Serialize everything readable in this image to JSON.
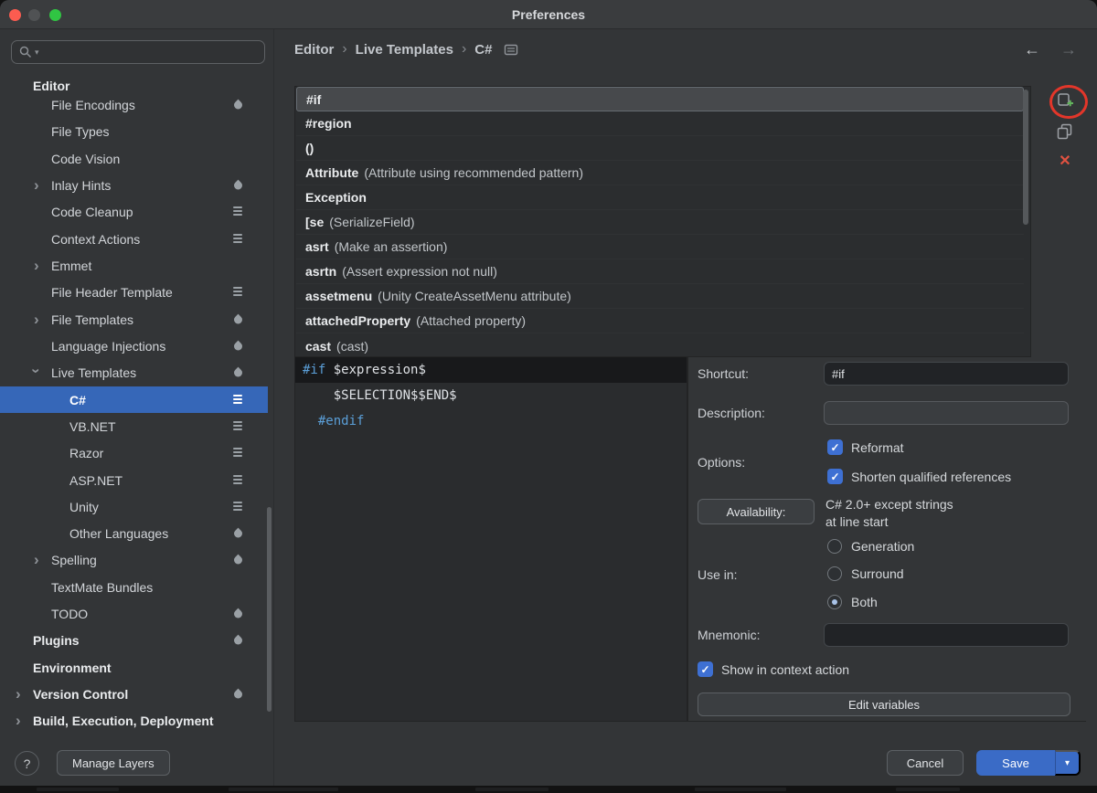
{
  "window": {
    "title": "Preferences"
  },
  "sidebar": {
    "search": {
      "placeholder": ""
    },
    "items": [
      {
        "label": "Editor",
        "level": 0,
        "bold": true
      },
      {
        "label": "File Encodings",
        "level": 1,
        "icon": "droplet"
      },
      {
        "label": "File Types",
        "level": 1
      },
      {
        "label": "Code Vision",
        "level": 1
      },
      {
        "label": "Inlay Hints",
        "level": 1,
        "chevron": "collapsed",
        "icon": "droplet"
      },
      {
        "label": "Code Cleanup",
        "level": 1,
        "icon": "stack"
      },
      {
        "label": "Context Actions",
        "level": 1,
        "icon": "stack"
      },
      {
        "label": "Emmet",
        "level": 1,
        "chevron": "collapsed"
      },
      {
        "label": "File Header Template",
        "level": 1,
        "icon": "stack"
      },
      {
        "label": "File Templates",
        "level": 1,
        "chevron": "collapsed",
        "icon": "droplet"
      },
      {
        "label": "Language Injections",
        "level": 1,
        "icon": "droplet"
      },
      {
        "label": "Live Templates",
        "level": 1,
        "chevron": "expanded",
        "icon": "droplet"
      },
      {
        "label": "C#",
        "level": 2,
        "selected": true,
        "icon": "stack"
      },
      {
        "label": "VB.NET",
        "level": 2,
        "icon": "stack"
      },
      {
        "label": "Razor",
        "level": 2,
        "icon": "stack"
      },
      {
        "label": "ASP.NET",
        "level": 2,
        "icon": "stack"
      },
      {
        "label": "Unity",
        "level": 2,
        "icon": "stack"
      },
      {
        "label": "Other Languages",
        "level": 2,
        "icon": "droplet"
      },
      {
        "label": "Spelling",
        "level": 1,
        "chevron": "collapsed",
        "icon": "droplet"
      },
      {
        "label": "TextMate Bundles",
        "level": 1
      },
      {
        "label": "TODO",
        "level": 1,
        "icon": "droplet"
      },
      {
        "label": "Plugins",
        "level": 0,
        "bold": true,
        "icon": "droplet"
      },
      {
        "label": "Environment",
        "level": 0,
        "bold": true
      },
      {
        "label": "Version Control",
        "level": 0,
        "bold": true,
        "chevron": "collapsed",
        "icon": "droplet"
      },
      {
        "label": "Build, Execution, Deployment",
        "level": 0,
        "bold": true,
        "chevron": "collapsed"
      }
    ]
  },
  "breadcrumb": {
    "parts": [
      "Editor",
      "Live Templates",
      "C#"
    ]
  },
  "templates": {
    "rows": [
      {
        "abbr": "#if",
        "desc": ""
      },
      {
        "abbr": "#region",
        "desc": ""
      },
      {
        "abbr": "()",
        "desc": ""
      },
      {
        "abbr": "Attribute",
        "desc": "(Attribute using recommended pattern)"
      },
      {
        "abbr": "Exception",
        "desc": ""
      },
      {
        "abbr": "[se",
        "desc": "(SerializeField)"
      },
      {
        "abbr": "asrt",
        "desc": "(Make an assertion)"
      },
      {
        "abbr": "asrtn",
        "desc": "(Assert expression not null)"
      },
      {
        "abbr": "assetmenu",
        "desc": "(Unity CreateAssetMenu attribute)"
      },
      {
        "abbr": "attachedProperty",
        "desc": "(Attached property)"
      },
      {
        "abbr": "cast",
        "desc": "(cast)"
      }
    ]
  },
  "preview": {
    "line1_kw": "#if",
    "line1_rest": " $expression$",
    "line2": "    $SELECTION$$END$",
    "line3": "  #endif"
  },
  "form": {
    "shortcut_label": "Shortcut:",
    "shortcut_value": "#if",
    "description_label": "Description:",
    "description_value": "",
    "options_label": "Options:",
    "reformat_label": "Reformat",
    "shorten_label": "Shorten qualified references",
    "availability_button": "Availability:",
    "availability_line1": "C# 2.0+ except strings",
    "availability_line2": "at line start",
    "use_in_label": "Use in:",
    "radio_generation": "Generation",
    "radio_surround": "Surround",
    "radio_both": "Both",
    "mnemonic_label": "Mnemonic:",
    "mnemonic_value": "",
    "show_in_context_label": "Show in context action",
    "edit_variables_button": "Edit variables"
  },
  "footer": {
    "help": "?",
    "manage_layers": "Manage Layers",
    "cancel": "Cancel",
    "save": "Save"
  },
  "colors": {
    "selection_blue": "#3667b8",
    "save_blue": "#3a6bc6",
    "checkbox_blue": "#3e70d3",
    "keyword_blue": "#5b9fd8",
    "delete_red": "#e15241",
    "annotation_red": "#e3362a"
  }
}
